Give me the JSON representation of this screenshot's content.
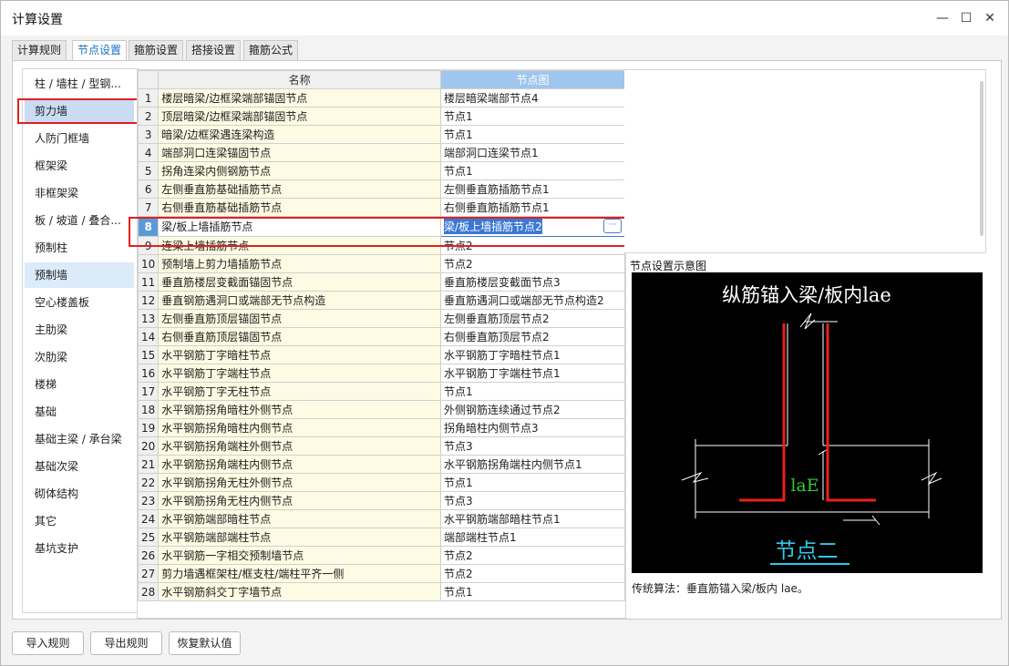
{
  "window": {
    "title": "计算设置",
    "minimize": "—",
    "maximize": "☐",
    "close": "✕"
  },
  "tabs": [
    "计算规则",
    "节点设置",
    "箍筋设置",
    "搭接设置",
    "箍筋公式"
  ],
  "active_tab": 1,
  "sidebar": [
    "柱 / 墙柱 / 型钢...",
    "剪力墙",
    "人防门框墙",
    "框架梁",
    "非框架梁",
    "板 / 坡道 / 叠合...",
    "预制柱",
    "预制墙",
    "空心楼盖板",
    "主肋梁",
    "次肋梁",
    "楼梯",
    "基础",
    "基础主梁 / 承台梁",
    "基础次梁",
    "砌体结构",
    "其它",
    "基坑支护"
  ],
  "sidebar_selected": 1,
  "sidebar_hover": 7,
  "table": {
    "headers": {
      "name": "名称",
      "node": "节点图"
    },
    "rows": [
      {
        "no": "1",
        "name": "楼层暗梁/边框梁端部锚固节点",
        "node": "楼层暗梁端部节点4"
      },
      {
        "no": "2",
        "name": "顶层暗梁/边框梁端部锚固节点",
        "node": "节点1"
      },
      {
        "no": "3",
        "name": "暗梁/边框梁遇连梁构造",
        "node": "节点1"
      },
      {
        "no": "4",
        "name": "端部洞口连梁锚固节点",
        "node": "端部洞口连梁节点1"
      },
      {
        "no": "5",
        "name": "拐角连梁内侧钢筋节点",
        "node": "节点1"
      },
      {
        "no": "6",
        "name": "左侧垂直筋基础插筋节点",
        "node": "左侧垂直筋插筋节点1"
      },
      {
        "no": "7",
        "name": "右侧垂直筋基础插筋节点",
        "node": "右侧垂直筋插筋节点1"
      },
      {
        "no": "8",
        "name": "梁/板上墙插筋节点",
        "node": "梁/板上墙插筋节点2"
      },
      {
        "no": "9",
        "name": "连梁上墙插筋节点",
        "node": "节点2"
      },
      {
        "no": "10",
        "name": "预制墙上剪力墙插筋节点",
        "node": "节点2"
      },
      {
        "no": "11",
        "name": "垂直筋楼层变截面锚固节点",
        "node": "垂直筋楼层变截面节点3"
      },
      {
        "no": "12",
        "name": "垂直钢筋遇洞口或端部无节点构造",
        "node": "垂直筋遇洞口或端部无节点构造2"
      },
      {
        "no": "13",
        "name": "左侧垂直筋顶层锚固节点",
        "node": "左侧垂直筋顶层节点2"
      },
      {
        "no": "14",
        "name": "右侧垂直筋顶层锚固节点",
        "node": "右侧垂直筋顶层节点2"
      },
      {
        "no": "15",
        "name": "水平钢筋丁字暗柱节点",
        "node": "水平钢筋丁字暗柱节点1"
      },
      {
        "no": "16",
        "name": "水平钢筋丁字端柱节点",
        "node": "水平钢筋丁字端柱节点1"
      },
      {
        "no": "17",
        "name": "水平钢筋丁字无柱节点",
        "node": "节点1"
      },
      {
        "no": "18",
        "name": "水平钢筋拐角暗柱外侧节点",
        "node": "外侧钢筋连续通过节点2"
      },
      {
        "no": "19",
        "name": "水平钢筋拐角暗柱内侧节点",
        "node": "拐角暗柱内侧节点3"
      },
      {
        "no": "20",
        "name": "水平钢筋拐角端柱外侧节点",
        "node": "节点3"
      },
      {
        "no": "21",
        "name": "水平钢筋拐角端柱内侧节点",
        "node": "水平钢筋拐角端柱内侧节点1"
      },
      {
        "no": "22",
        "name": "水平钢筋拐角无柱外侧节点",
        "node": "节点1"
      },
      {
        "no": "23",
        "name": "水平钢筋拐角无柱内侧节点",
        "node": "节点3"
      },
      {
        "no": "24",
        "name": "水平钢筋端部暗柱节点",
        "node": "水平钢筋端部暗柱节点1"
      },
      {
        "no": "25",
        "name": "水平钢筋端部端柱节点",
        "node": "端部端柱节点1"
      },
      {
        "no": "26",
        "name": "水平钢筋一字相交预制墙节点",
        "node": "节点2"
      },
      {
        "no": "27",
        "name": "剪力墙遇框架柱/框支柱/端柱平齐一侧",
        "node": "节点2"
      },
      {
        "no": "28",
        "name": "水平钢筋斜交丁字墙节点",
        "node": "节点1"
      }
    ],
    "selected_row": 7,
    "ellipsis": "···"
  },
  "preview": {
    "label": "节点设置示意图",
    "heading": "纵筋锚入梁/板内lae",
    "dim_label": "laE",
    "footer": "节点二",
    "caption": "传统算法：垂直筋锚入梁/板内 lae。",
    "colors": {
      "bg": "#000000",
      "rebar": "#e8201c",
      "line": "#ffffff",
      "dim": "#33cc33",
      "footer": "#2ec8e8"
    }
  },
  "buttons": {
    "import": "导入规则",
    "export": "导出规则",
    "restore": "恢复默认值"
  }
}
